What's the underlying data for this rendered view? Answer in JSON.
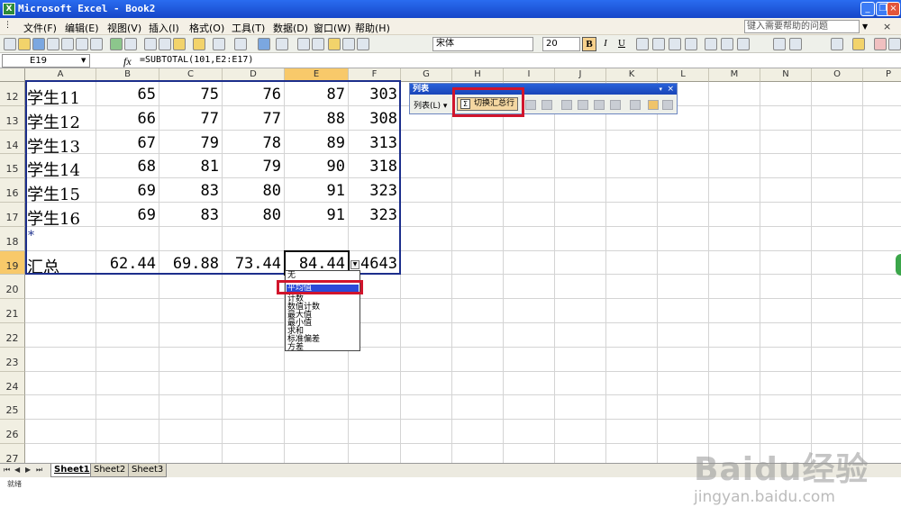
{
  "window": {
    "title": "Microsoft Excel - Book2",
    "app_icon": "excel-icon"
  },
  "menu": {
    "items": [
      "文件(F)",
      "编辑(E)",
      "视图(V)",
      "插入(I)",
      "格式(O)",
      "工具(T)",
      "数据(D)",
      "窗口(W)",
      "帮助(H)"
    ],
    "help_placeholder": "键入需要帮助的问题",
    "close_glyph": "×"
  },
  "toolbar": {
    "font_name": "宋体",
    "font_size": "20",
    "bold": "B",
    "italic": "I",
    "underline": "U",
    "icons": [
      "new-icon",
      "open-icon",
      "save-icon",
      "permission-icon",
      "email-icon",
      "print-icon",
      "print-preview-icon",
      "spelling-icon",
      "research-icon",
      "cut-icon",
      "copy-icon",
      "paste-icon",
      "format-painter-icon",
      "undo-icon",
      "redo-icon",
      "hyperlink-icon",
      "autosum-icon",
      "sort-ascending-icon",
      "sort-descending-icon",
      "chart-wizard-icon",
      "drawing-icon",
      "zoom-icon",
      "align-left-icon",
      "center-icon",
      "align-right-icon",
      "merge-center-icon",
      "currency-icon",
      "percent-icon",
      "comma-icon",
      "decrease-indent-icon",
      "increase-indent-icon",
      "borders-icon",
      "fill-color-icon",
      "font-color-icon",
      "options-icon"
    ]
  },
  "formula_bar": {
    "name_box": "E19",
    "fx": "fx",
    "formula": "=SUBTOTAL(101,E2:E17)"
  },
  "columns": [
    "A",
    "B",
    "C",
    "D",
    "E",
    "F",
    "G",
    "H",
    "I",
    "J",
    "K",
    "L",
    "M",
    "N",
    "O",
    "P"
  ],
  "selected_column": "E",
  "rows": [
    "12",
    "13",
    "14",
    "15",
    "16",
    "17",
    "18",
    "19",
    "20",
    "21",
    "22",
    "23",
    "24",
    "25",
    "26",
    "27"
  ],
  "selected_row": "19",
  "table": [
    {
      "name": "学生11",
      "b": "65",
      "c": "75",
      "d": "76",
      "e": "87",
      "f": "303"
    },
    {
      "name": "学生12",
      "b": "66",
      "c": "77",
      "d": "77",
      "e": "88",
      "f": "308"
    },
    {
      "name": "学生13",
      "b": "67",
      "c": "79",
      "d": "78",
      "e": "89",
      "f": "313"
    },
    {
      "name": "学生14",
      "b": "68",
      "c": "81",
      "d": "79",
      "e": "90",
      "f": "318"
    },
    {
      "name": "学生15",
      "b": "69",
      "c": "83",
      "d": "80",
      "e": "91",
      "f": "323"
    },
    {
      "name": "学生16",
      "b": "69",
      "c": "83",
      "d": "80",
      "e": "91",
      "f": "323"
    }
  ],
  "insert_row_marker": "*",
  "total_row": {
    "name": "汇总",
    "b": "62.44",
    "c": "69.88",
    "d": "73.44",
    "e": "84.44",
    "f": "4643"
  },
  "dropdown": {
    "items": [
      "无",
      "平均值",
      "计数",
      "数值计数",
      "最大值",
      "最小值",
      "求和",
      "标准偏差",
      "方差"
    ],
    "highlighted": "平均值"
  },
  "list_toolbar": {
    "title": "列表",
    "list_menu": "列表(L) ▾",
    "toggle_total": "切换汇总行",
    "close": "×",
    "menu_arrow": "▾"
  },
  "sheets": [
    "Sheet1",
    "Sheet2",
    "Sheet3"
  ],
  "active_sheet": "Sheet1",
  "status": "就绪",
  "colors": {
    "title_blue": "#1f57e0",
    "highlight_red": "#d1152c",
    "list_border": "#1c2e8c",
    "selection_blue": "#2b4ad8"
  }
}
